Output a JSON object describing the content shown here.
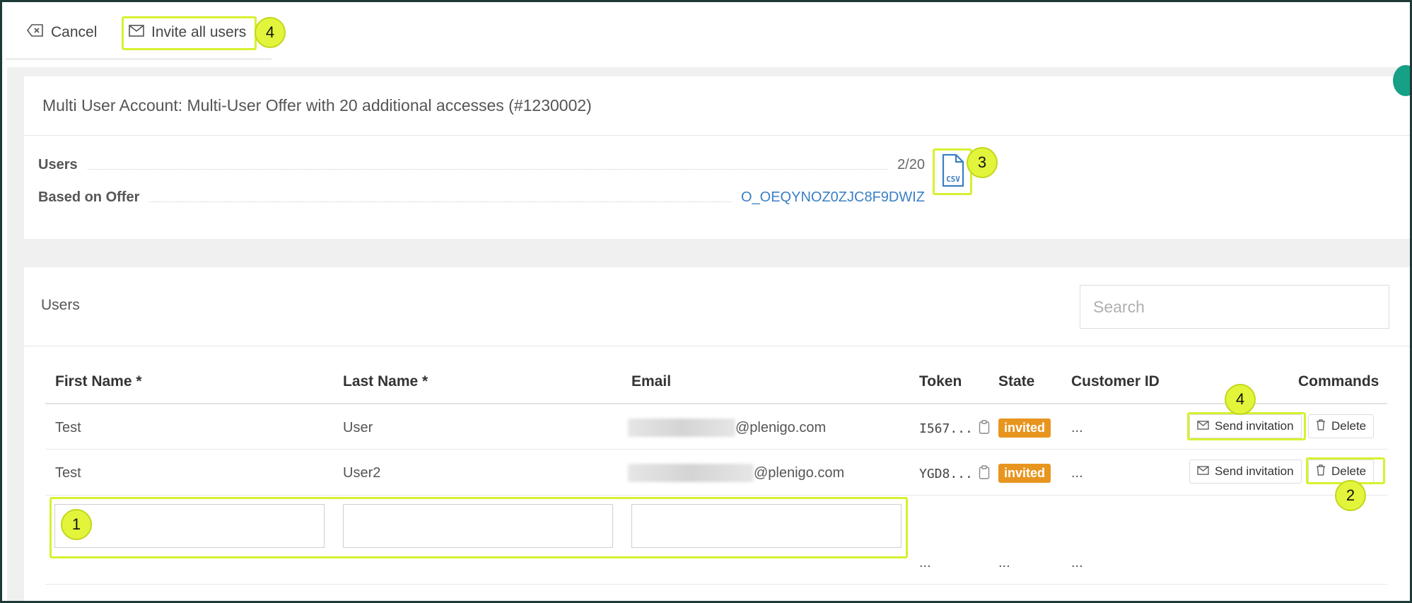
{
  "toolbar": {
    "cancel_label": "Cancel",
    "invite_all_label": "Invite all users"
  },
  "account": {
    "title": "Multi User Account: Multi-User Offer with 20 additional accesses (#1230002)",
    "users_label": "Users",
    "users_value": "2/20",
    "offer_label": "Based on Offer",
    "offer_value": "O_OEQYNOZ0ZJC8F9DWIZ",
    "csv_label": "CSV"
  },
  "users_panel": {
    "title": "Users",
    "search_placeholder": "Search"
  },
  "table": {
    "headers": {
      "first_name": "First Name *",
      "last_name": "Last Name *",
      "email": "Email",
      "token": "Token",
      "state": "State",
      "customer_id": "Customer ID",
      "commands": "Commands"
    },
    "rows": [
      {
        "first_name": "Test",
        "last_name": "User",
        "email_domain": "@plenigo.com",
        "token": "I567...",
        "state": "invited",
        "customer_id": "..."
      },
      {
        "first_name": "Test",
        "last_name": "User2",
        "email_domain": "@plenigo.com",
        "token": "YGD8...",
        "state": "invited",
        "customer_id": "..."
      }
    ],
    "new_row": {
      "token": "...",
      "state": "...",
      "customer_id": "..."
    },
    "send_invitation_label": "Send invitation",
    "delete_label": "Delete"
  },
  "annotations": {
    "n1": "1",
    "n2": "2",
    "n3": "3",
    "n4a": "4",
    "n4b": "4"
  },
  "colors": {
    "highlight": "#d7f12f",
    "badge": "#e8951f",
    "link": "#3b7fc4",
    "accent_dot": "#16a085"
  }
}
